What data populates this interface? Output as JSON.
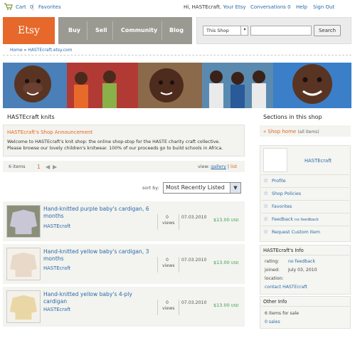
{
  "topbar": {
    "cart_label": "Cart",
    "cart_count": "0",
    "favorites_label": "Favorites",
    "greeting": "Hi, HASTEcraft.",
    "your_etsy": "Your Etsy",
    "conversations": "Conversations",
    "conversations_count": "0",
    "help": "Help",
    "sign_out": "Sign Out"
  },
  "header": {
    "logo": "Etsy",
    "nav": [
      "Buy",
      "Sell",
      "Community",
      "Blog"
    ],
    "search_scope": "This Shop",
    "search_button": "Search",
    "search_value": ""
  },
  "breadcrumb": {
    "home": "Home",
    "sep": "»",
    "shop": "HASTEcraft.etsy.com"
  },
  "shop": {
    "title": "HASTEcraft knits",
    "announcement_title": "HASTEcraft's Shop Announcement",
    "announcement_text": "Welcome to HASTEcraft's knit shop: the online shop-stop for the HASTE charity craft collective. Please browse our lovely children's knitwear. 100% of our proceeds go to build schools in Africa."
  },
  "pager": {
    "items": "6 items",
    "page": "1",
    "prev": "◀",
    "next": "▶",
    "view_label": "view:",
    "view_gallery": "gallery",
    "view_sep": "|",
    "view_list": "list"
  },
  "sort": {
    "label": "sort by:",
    "selected": "Most Recently Listed",
    "arrow": "▼"
  },
  "listings": [
    {
      "title": "Hand-knitted purple baby's cardigan, 6 months",
      "seller": "HASTEcraft",
      "views": "0",
      "views_label": "views",
      "date": "07.03.2010",
      "price": "$13.00",
      "currency": "USD",
      "color": "#c9c6d6"
    },
    {
      "title": "Hand-knitted yellow baby's cardigan, 3 months",
      "seller": "HASTEcraft",
      "views": "0",
      "views_label": "views",
      "date": "07.03.2010",
      "price": "$13.00",
      "currency": "USD",
      "color": "#e8d9c8"
    },
    {
      "title": "Hand-knitted yellow baby's 4-ply cardigan",
      "seller": "HASTEcraft",
      "views": "0",
      "views_label": "views",
      "date": "07.03.2010",
      "price": "$13.00",
      "currency": "USD",
      "color": "#e9d7a6"
    }
  ],
  "sidebar": {
    "sections_title": "Sections in this shop",
    "shop_home": "Shop home",
    "shop_home_count": "(all items)",
    "seller": "HASTEcraft",
    "links": [
      "Profile",
      "Shop Policies",
      "Favorites",
      "Feedback",
      "Request Custom Item"
    ],
    "feedback_note": "no feedback",
    "info_title": "HASTEcraft's Info",
    "rating_label": "rating:",
    "rating_value": "no feedback",
    "joined_label": "joined:",
    "joined_value": "July 03, 2010",
    "location_label": "location:",
    "location_value": "",
    "contact": "contact HASTEcraft",
    "other_title": "Other Info",
    "items_for_sale": "6 items for sale",
    "sales": "0 sales"
  },
  "colors": {
    "brand": "#e6682a",
    "link": "#2a6aa8",
    "price": "#3aa14a",
    "accent_orange": "#e06a1e",
    "nav_bg": "#9b9a92"
  }
}
